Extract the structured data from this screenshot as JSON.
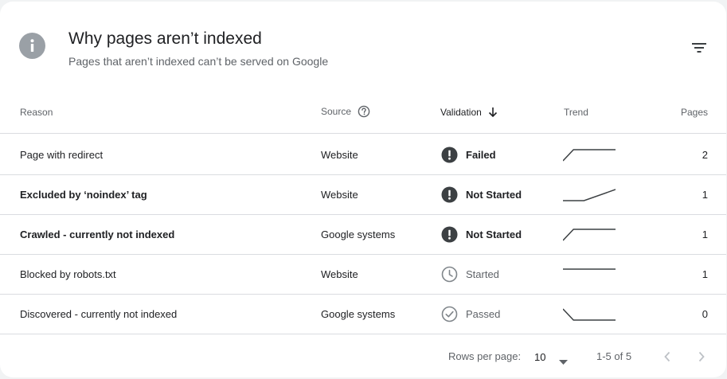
{
  "header": {
    "title": "Why pages aren’t indexed",
    "subtitle": "Pages that aren’t indexed can’t be served on Google",
    "icon": "info-icon",
    "filter_icon": "filter-icon"
  },
  "table": {
    "columns": {
      "reason": "Reason",
      "source": "Source",
      "validation": "Validation",
      "trend": "Trend",
      "pages": "Pages"
    },
    "rows": [
      {
        "reason": "Page with redirect",
        "source": "Website",
        "validation": "Failed",
        "status": "alert",
        "pages": "2",
        "trend": [
          0,
          1,
          1,
          1
        ]
      },
      {
        "reason": "Excluded by ‘noindex’ tag",
        "source": "Website",
        "validation": "Not Started",
        "status": "alert",
        "pages": "1",
        "trend": [
          0,
          0,
          0,
          1
        ]
      },
      {
        "reason": "Crawled - currently not indexed",
        "source": "Google systems",
        "validation": "Not Started",
        "status": "alert",
        "pages": "1",
        "trend": [
          0,
          1,
          1,
          1
        ]
      },
      {
        "reason": "Blocked by robots.txt",
        "source": "Website",
        "validation": "Started",
        "status": "clock",
        "pages": "1",
        "trend": [
          1,
          1,
          1,
          1
        ]
      },
      {
        "reason": "Discovered - currently not indexed",
        "source": "Google systems",
        "validation": "Passed",
        "status": "check",
        "pages": "0",
        "trend": [
          1,
          0,
          0,
          0
        ]
      }
    ]
  },
  "footer": {
    "rows_per_page_label": "Rows per page:",
    "rows_per_page_value": "10",
    "range": "1-5 of 5"
  },
  "colors": {
    "alert": "#3c4043",
    "muted": "#80868b",
    "divider": "#dadce0",
    "trend_line": "#3c4043"
  }
}
